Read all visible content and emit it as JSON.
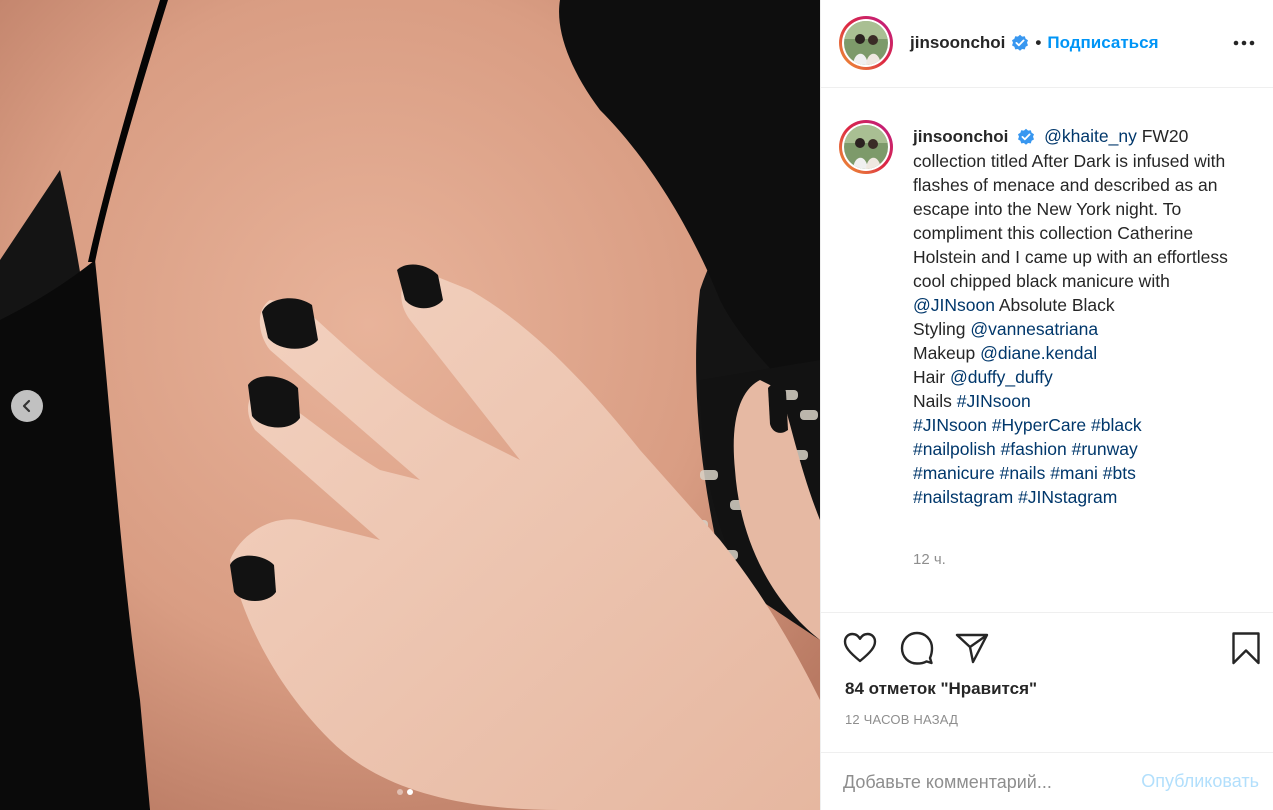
{
  "photo": {
    "description_icon": "hand-with-black-nails-photo",
    "carousel": {
      "count": 2,
      "active_index": 1
    }
  },
  "header": {
    "username": "jinsoonchoi",
    "separator": "•",
    "follow_label": "Подписаться",
    "more_icon": "more-dots-icon"
  },
  "caption": {
    "username": "jinsoonchoi",
    "mention_khaite": "@khaite_ny",
    "text_1": " FW20 collection titled After Dark is infused with flashes of menace and described as an escape into the New York night. To compliment this collection Catherine Holstein and I came up with an effortless cool chipped black manicure with ",
    "mention_jinsoon": "@JINsoon",
    "text_2": " Absolute Black",
    "styling_label": "Styling ",
    "styling_mention": "@vannesatriana",
    "makeup_label": "Makeup ",
    "makeup_mention": "@diane.kendal",
    "hair_label": "Hair ",
    "hair_mention": "@duffy_duffy",
    "nails_label": "Nails ",
    "nails_tag": "#JINsoon",
    "hashtags_1": [
      "#JINsoon",
      "#HyperCare",
      "#black"
    ],
    "hashtags_2": [
      "#nailpolish",
      "#fashion",
      "#runway"
    ],
    "hashtags_3": [
      "#manicure",
      "#nails",
      "#mani",
      "#bts"
    ],
    "hashtags_4": [
      "#nailstagram",
      "#JINstagram"
    ],
    "time": "12 ч."
  },
  "actions": {
    "likes": "84 отметок \"Нравится\"",
    "ago": "12 ЧАСОВ НАЗАД"
  },
  "comment": {
    "placeholder": "Добавьте комментарий...",
    "post_label": "Опубликовать"
  },
  "colors": {
    "accent": "#0095f6",
    "link": "#00376b",
    "muted": "#8e8e8e",
    "post_disabled": "#b2dffc"
  }
}
